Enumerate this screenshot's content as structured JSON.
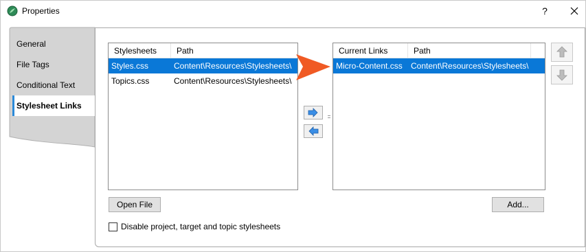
{
  "window": {
    "title": "Properties",
    "help_label": "?",
    "accent": "#0a78d7"
  },
  "tabs": [
    {
      "label": "General"
    },
    {
      "label": "File Tags"
    },
    {
      "label": "Conditional Text"
    },
    {
      "label": "Stylesheet Links",
      "active": true
    }
  ],
  "stylesheets": {
    "columns": [
      "Stylesheets",
      "Path"
    ],
    "rows": [
      {
        "name": "Styles.css",
        "path": "Content\\Resources\\Stylesheets\\",
        "selected": true
      },
      {
        "name": "Topics.css",
        "path": "Content\\Resources\\Stylesheets\\",
        "selected": false
      }
    ]
  },
  "current_links": {
    "columns": [
      "Current Links",
      "Path"
    ],
    "rows": [
      {
        "name": "Micro-Content.css",
        "path": "Content\\Resources\\Stylesheets\\",
        "selected": true
      }
    ]
  },
  "buttons": {
    "open_file": "Open File",
    "add": "Add...",
    "move_right_icon": "arrow-right-icon",
    "move_left_icon": "arrow-left-icon",
    "move_up_icon": "arrow-up-icon",
    "move_down_icon": "arrow-down-icon"
  },
  "options": {
    "disable_label": "Disable project, target and topic stylesheets",
    "disable_checked": false
  }
}
